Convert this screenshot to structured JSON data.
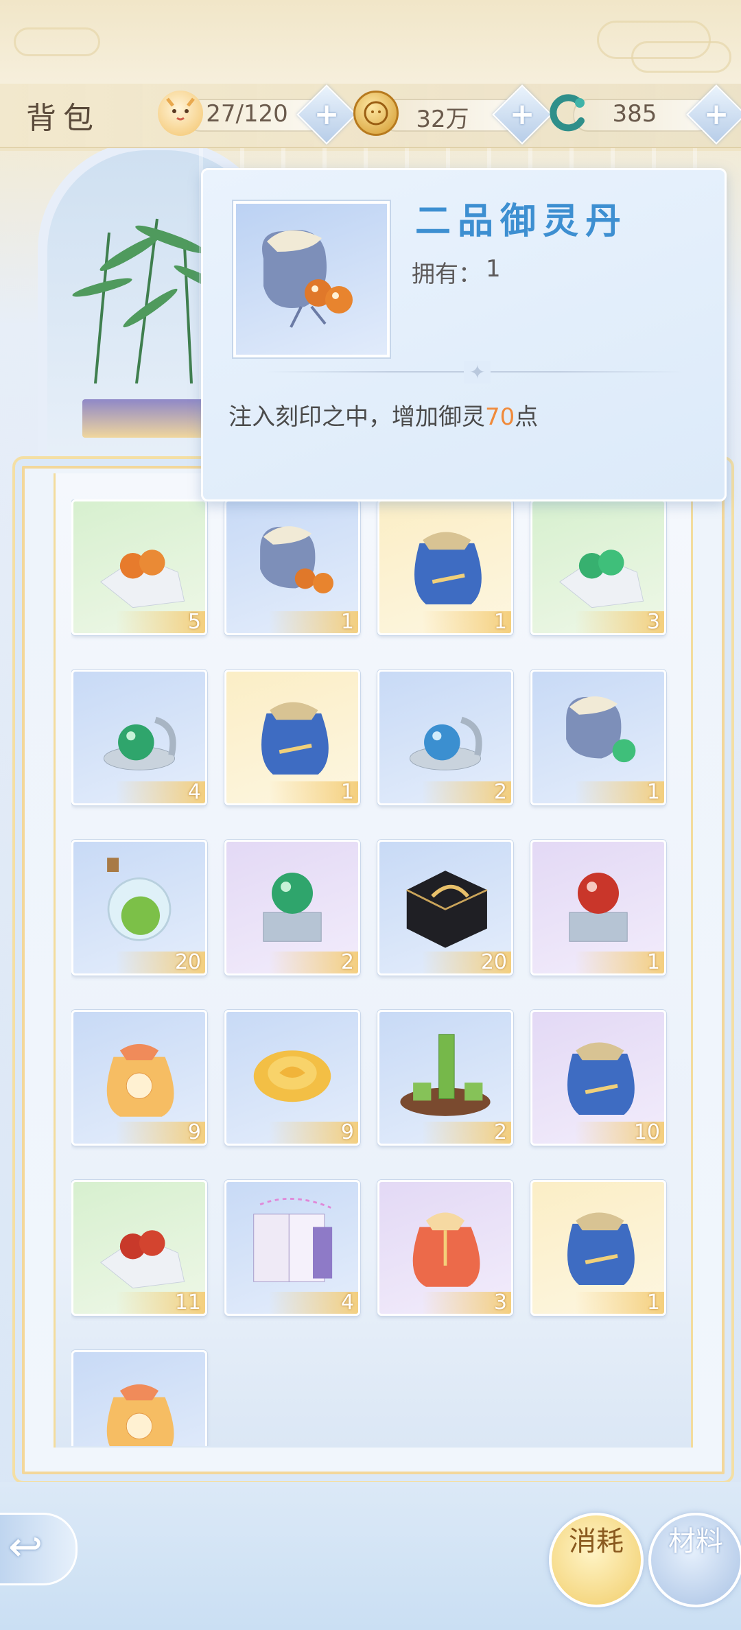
{
  "header": {
    "title": "背包",
    "resources": [
      {
        "name": "capacity",
        "value": "27/120",
        "icon": "cat-face-icon"
      },
      {
        "name": "coins",
        "value": "32万",
        "icon": "gold-coin-icon"
      },
      {
        "name": "jade",
        "value": "385",
        "icon": "jade-dragon-icon"
      }
    ]
  },
  "tooltip": {
    "name": "二品御灵丹",
    "own_label": "拥有：",
    "own_value": "1",
    "desc_prefix": "注入刻印之中，增加御灵",
    "desc_highlight": "70",
    "desc_suffix": "点",
    "highlight_color": "#f08a3a"
  },
  "inventory": {
    "items": [
      {
        "icon": "orange-pills-on-cloth-icon",
        "count": "5",
        "bg": "green"
      },
      {
        "icon": "grey-pouch-orange-pills-icon",
        "count": "1",
        "bg": "blue"
      },
      {
        "icon": "blue-treasure-bag-icon",
        "count": "1",
        "bg": "gold"
      },
      {
        "icon": "green-pills-on-cloth-icon",
        "count": "3",
        "bg": "green"
      },
      {
        "icon": "green-orb-in-case-icon",
        "count": "4",
        "bg": "blue"
      },
      {
        "icon": "blue-treasure-bag-icon",
        "count": "1",
        "bg": "gold"
      },
      {
        "icon": "blue-orb-in-case-icon",
        "count": "2",
        "bg": "blue"
      },
      {
        "icon": "grey-pouch-green-pill-icon",
        "count": "1",
        "bg": "blue"
      },
      {
        "icon": "green-potion-flask-icon",
        "count": "20",
        "bg": "blue"
      },
      {
        "icon": "green-orb-on-box-icon",
        "count": "2",
        "bg": "purple"
      },
      {
        "icon": "black-gift-box-icon",
        "count": "20",
        "bg": "blue"
      },
      {
        "icon": "red-orb-on-box-icon",
        "count": "1",
        "bg": "purple"
      },
      {
        "icon": "xuan-lucky-bag-icon",
        "count": "9",
        "bg": "blue"
      },
      {
        "icon": "golden-rose-icon",
        "count": "9",
        "bg": "blue"
      },
      {
        "icon": "bamboo-tea-set-icon",
        "count": "2",
        "bg": "blue"
      },
      {
        "icon": "blue-treasure-bag-icon",
        "count": "10",
        "bg": "purple"
      },
      {
        "icon": "red-pills-on-cloth-icon",
        "count": "11",
        "bg": "green"
      },
      {
        "icon": "music-score-book-icon",
        "count": "4",
        "bg": "blue"
      },
      {
        "icon": "red-silk-pouch-icon",
        "count": "3",
        "bg": "purple"
      },
      {
        "icon": "blue-treasure-bag-icon",
        "count": "1",
        "bg": "gold"
      },
      {
        "icon": "xuan-lucky-bag-icon",
        "count": "",
        "bg": "blue"
      }
    ]
  },
  "bottom": {
    "back_icon": "back-arrow-icon",
    "tabs": [
      {
        "label": "消耗",
        "active": true
      },
      {
        "label": "材料",
        "active": false
      }
    ]
  }
}
